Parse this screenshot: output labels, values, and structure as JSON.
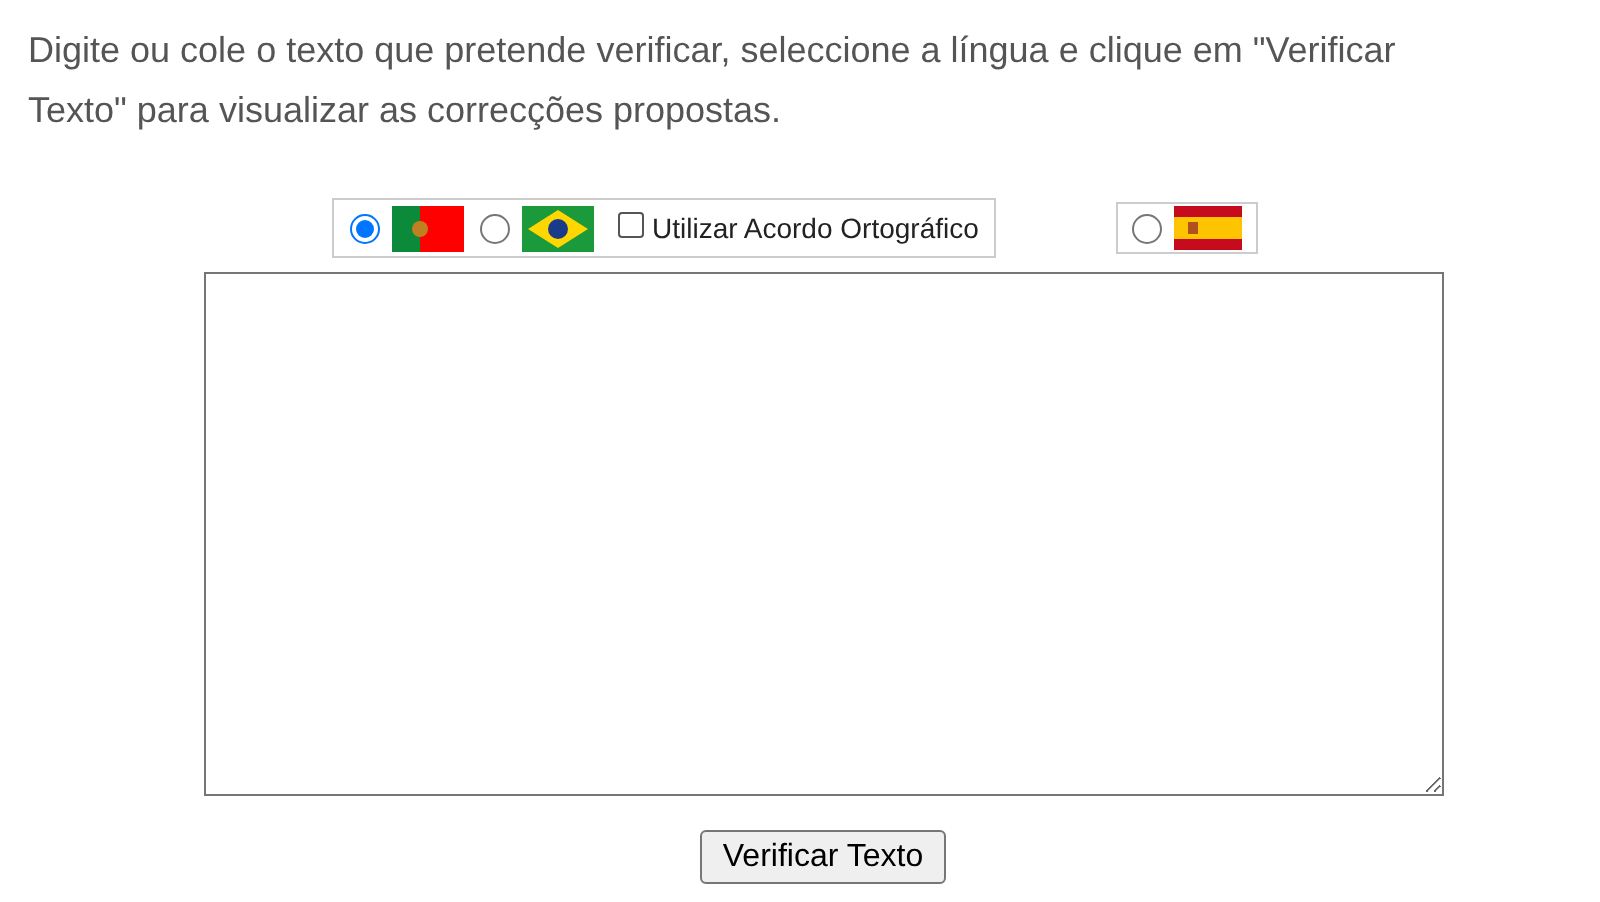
{
  "instructions": "Digite ou cole o texto que pretende verificar, seleccione a língua e clique em \"Verificar Texto\" para visualizar as correcções propostas.",
  "languages": [
    {
      "kind": "pt",
      "selected": true
    },
    {
      "kind": "br",
      "selected": false
    },
    {
      "kind": "es",
      "selected": false
    }
  ],
  "agreement_checkbox": {
    "label": "Utilizar Acordo Ortográfico",
    "checked": false
  },
  "submit_button": "Verificar Texto"
}
